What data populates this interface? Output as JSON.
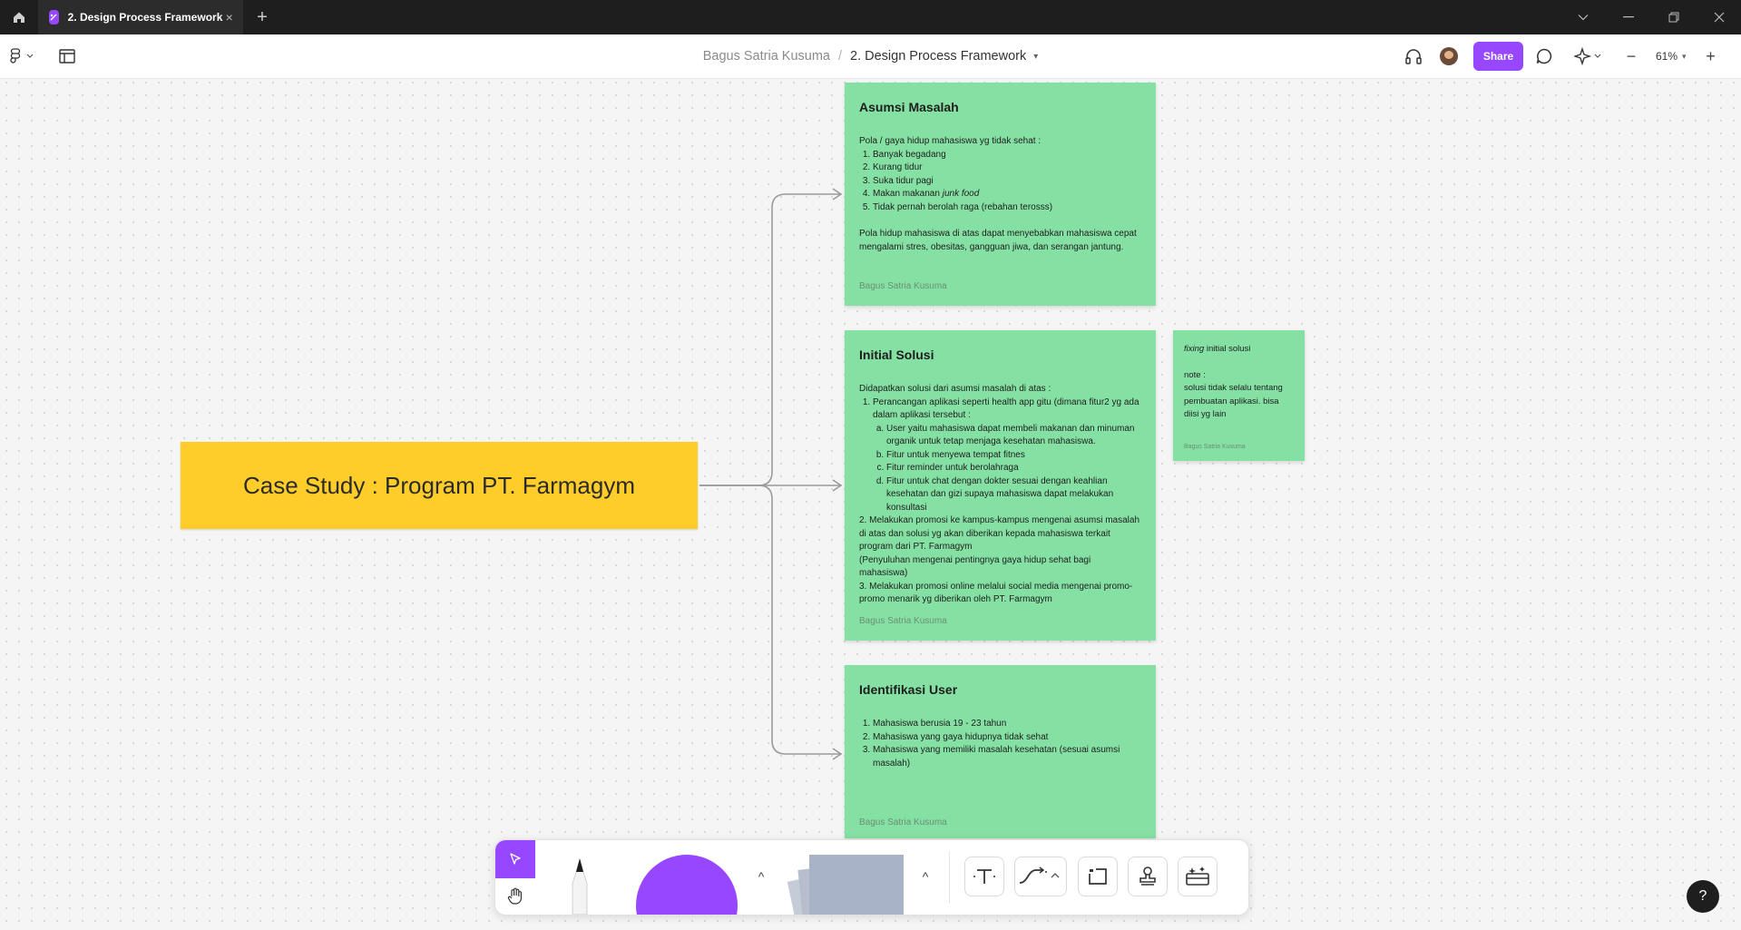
{
  "window": {
    "tab_title": "2. Design Process Framework",
    "tab_close": "×",
    "new_tab": "+"
  },
  "toolbar": {
    "owner": "Bagus Satria Kusuma",
    "separator": "/",
    "file_name": "2. Design Process Framework",
    "share_label": "Share",
    "zoom": "61%",
    "zoom_minus": "−",
    "zoom_plus": "+"
  },
  "canvas": {
    "case_title": "Case Study : Program PT. Farmagym",
    "notes": {
      "asumsi": {
        "title": "Asumsi Masalah",
        "intro": "Pola / gaya hidup mahasiswa yg tidak sehat :",
        "items": [
          "Banyak begadang",
          "Kurang tidur",
          "Suka tidur pagi",
          "Makan makanan ",
          "Tidak pernah berolah raga (rebahan terosss)"
        ],
        "item4_em": "junk food",
        "body": "Pola hidup mahasiswa di atas dapat menyebabkan mahasiswa cepat mengalami stres, obesitas, gangguan jiwa, dan serangan jantung.",
        "author": "Bagus Satria Kusuma"
      },
      "solusi": {
        "title": "Initial Solusi",
        "intro": "Didapatkan solusi dari asumsi masalah di atas :",
        "item1": "Perancangan aplikasi seperti health app gitu (dimana fitur2 yg ada dalam aplikasi tersebut :",
        "subitems": [
          "User yaitu mahasiswa dapat membeli makanan dan minuman organik untuk tetap menjaga kesehatan mahasiswa.",
          "Fitur untuk menyewa tempat fitnes",
          "Fitur reminder untuk berolahraga",
          "Fitur untuk chat dengan dokter sesuai dengan keahlian kesehatan dan gizi supaya mahasiswa dapat melakukan konsultasi"
        ],
        "para2": "2.  Melakukan promosi ke kampus-kampus mengenai asumsi masalah di atas dan solusi yg akan diberikan kepada mahasiswa terkait program dari PT. Farmagym",
        "para2b": "(Penyuluhan mengenai pentingnya gaya hidup sehat bagi mahasiswa)",
        "para3": "3.  Melakukan promosi online melalui social media mengenai promo-promo menarik yg diberikan oleh PT. Farmagym",
        "author": "Bagus Satria Kusuma"
      },
      "user": {
        "title": "Identifikasi User",
        "items": [
          "Mahasiswa berusia 19 - 23 tahun",
          "Mahasiswa yang gaya hidupnya tidak sehat",
          "Mahasiswa yang memiliki masalah kesehatan (sesuai asumsi masalah)"
        ],
        "author": "Bagus Satria Kusuma"
      },
      "fixing": {
        "title_em": "fixing",
        "title_rest": " initial solusi",
        "note_label": "note :",
        "note_body": "solusi tidak selalu tentang pembuatan aplikasi. bisa diisi yg lain",
        "author": "Bagus Satria Kusuma"
      }
    }
  },
  "dock": {
    "caret": "^"
  },
  "help": "?",
  "colors": {
    "accent": "#9747ff",
    "sticky_green": "#85e0a3",
    "case_yellow": "#ffcd29",
    "titlebar": "#1e1e1e"
  }
}
